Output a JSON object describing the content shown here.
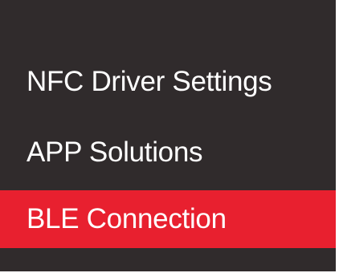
{
  "menu": {
    "active_color": "#e8202f",
    "background_color": "#302b2c",
    "items": [
      {
        "label": "NFC Driver Settings",
        "active": false
      },
      {
        "label": "APP Solutions",
        "active": false
      },
      {
        "label": "BLE Connection",
        "active": true
      }
    ]
  }
}
